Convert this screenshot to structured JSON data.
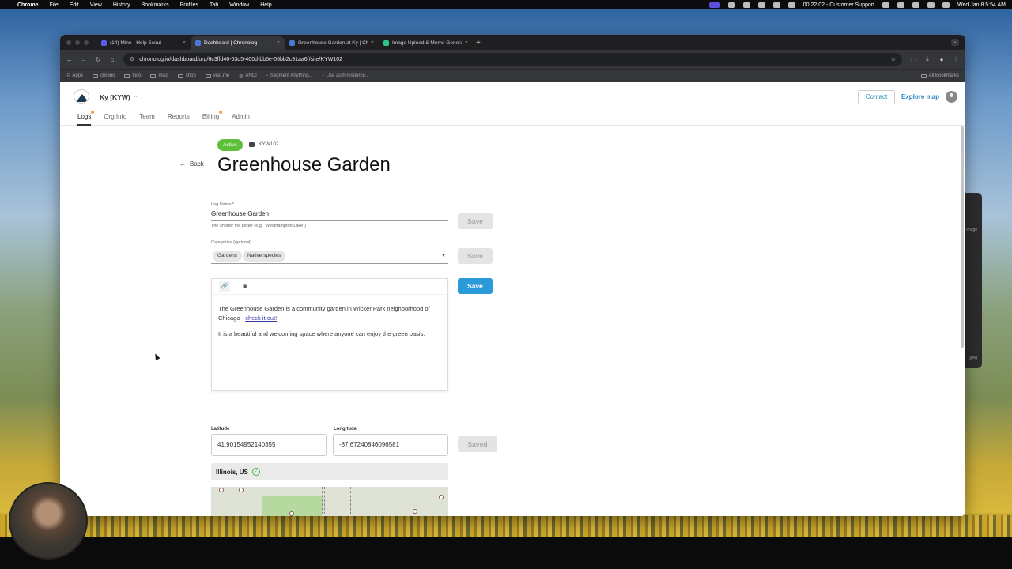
{
  "menubar": {
    "apple": "",
    "app": "Chrome",
    "menus": [
      "File",
      "Edit",
      "View",
      "History",
      "Bookmarks",
      "Profiles",
      "Tab",
      "Window",
      "Help"
    ],
    "timer": "00:22:02 - Customer Support",
    "clock": "Wed Jan 8  5:54 AM"
  },
  "tabs": [
    {
      "label": "(14) Mine - Help Scout",
      "close": "×"
    },
    {
      "label": "Dashboard | Chronolog",
      "close": "×"
    },
    {
      "label": "Greenhouse Garden at Ky | Chronolog",
      "close": "×"
    },
    {
      "label": "Image Upload & Meme Generator",
      "close": "×"
    }
  ],
  "new_tab": "+",
  "address": "chronolog.io/dashboard/org/6c3ffd46-63d5-400d-bb5e-06bb2c91aa6f/site/KYW102",
  "bookmarks": {
    "items": [
      "Apps",
      "chrono",
      "loco",
      "misc",
      "shop",
      "visit.me",
      "ANDI",
      "Segment Anything...",
      "Use auth resource..."
    ],
    "all": "All Bookmarks"
  },
  "header": {
    "org": "Ky (KYW)",
    "org_chevron": "⌃",
    "contact": "Contact",
    "explore": "Explore map"
  },
  "nav": [
    "Logs",
    "Org Info",
    "Team",
    "Reports",
    "Billing",
    "Admin"
  ],
  "site": {
    "status": "Active",
    "code": "KYW102",
    "back": "Back",
    "back_arrow": "←",
    "title": "Greenhouse Garden"
  },
  "form": {
    "log_name_label": "Log Name *",
    "log_name_value": "Greenhouse Garden",
    "log_name_hint": "The shorter the better (e.g. \"Westhampton Lake\")",
    "categories_label": "Categories (optional)",
    "categories": [
      "Gardens",
      "Native species"
    ],
    "save": "Save",
    "saved": "Saved",
    "editor_p1_text": "The Greenhouse Garden is a community garden in Wicker Park neighborhood of Chicago - ",
    "editor_p1_link": "check it out!",
    "editor_p2": "It is a beautiful and welcoming space where anyone can enjoy the green oasis.",
    "latitude_label": "Latitude",
    "latitude_value": "41.90154952140355",
    "longitude_label": "Longitude",
    "longitude_value": "-87.67240846096581",
    "region": "Illinois, US"
  },
  "ghost_window": {
    "label1": "image",
    "label2": ".jpeg"
  }
}
